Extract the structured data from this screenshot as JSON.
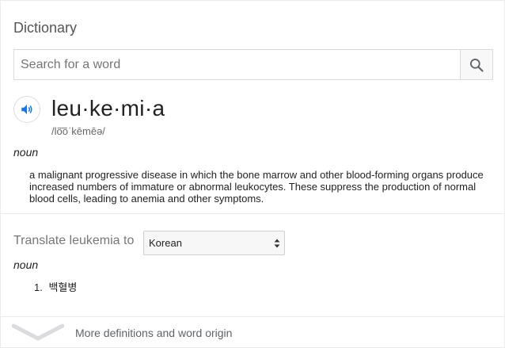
{
  "header": {
    "title": "Dictionary"
  },
  "search": {
    "placeholder": "Search for a word",
    "value": ""
  },
  "entry": {
    "word": "leu·ke·mi·a",
    "phonetic": "/lo͞oˈkēmēə/",
    "part_of_speech": "noun",
    "definition": "a malignant progressive disease in which the bone marrow and other blood-forming organs produce increased numbers of immature or abnormal leukocytes. These suppress the production of normal blood cells, leading to anemia and other symptoms."
  },
  "translate": {
    "label": "Translate leukemia to",
    "selected_language": "Korean",
    "part_of_speech": "noun",
    "items": [
      {
        "number": "1.",
        "text": "백혈병"
      }
    ]
  },
  "footer": {
    "more_label": "More definitions and word origin"
  },
  "icons": {
    "search": "search-icon",
    "speaker": "speaker-icon",
    "expand": "chevron-down-icon",
    "select": "select-arrows-icon"
  },
  "colors": {
    "accent": "#1a73e8",
    "text": "#222222",
    "muted": "#777777",
    "divider": "#ebebeb"
  }
}
